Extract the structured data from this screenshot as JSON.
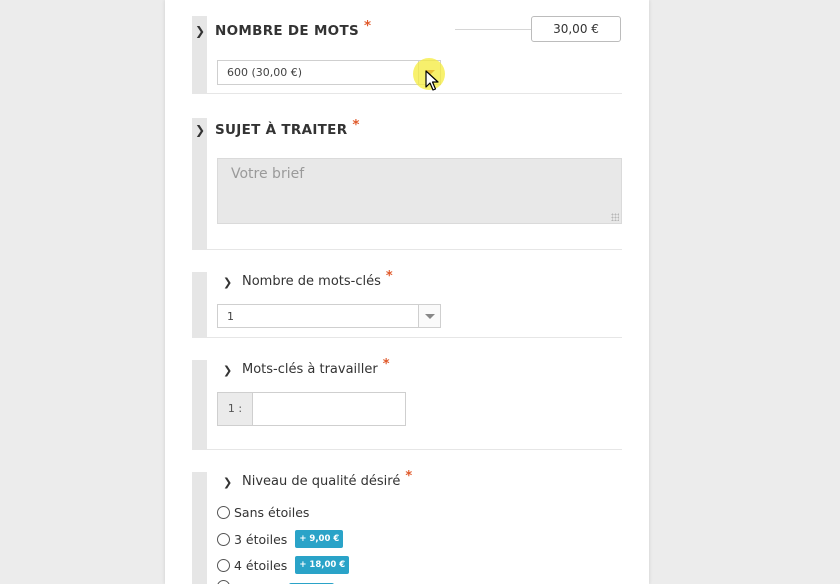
{
  "form": {
    "word_count": {
      "title": "NOMBRE DE MOTS",
      "required_mark": "*",
      "price": "30,00 €",
      "selected_option": "600 (30,00 €)"
    },
    "subject": {
      "title": "SUJET À TRAITER",
      "required_mark": "*",
      "placeholder": "Votre brief"
    },
    "keyword_count": {
      "title": "Nombre de mots-clés",
      "required_mark": "*",
      "selected_option": "1"
    },
    "keywords": {
      "title": "Mots-clés à travailler",
      "required_mark": "*",
      "prefix": "1 :",
      "value": ""
    },
    "quality": {
      "title": "Niveau de qualité désiré",
      "required_mark": "*",
      "options": [
        {
          "label": "Sans étoiles",
          "badge": ""
        },
        {
          "label": "3 étoiles",
          "badge": "+ 9,00 €"
        },
        {
          "label": "4 étoiles",
          "badge": "+ 18,00 €"
        }
      ]
    }
  },
  "colors": {
    "accent_star": "#e0592a",
    "badge": "#2aa3c8",
    "cursor_highlight": "#f5ec3c"
  },
  "icons": [
    "chevron-right-icon",
    "dropdown-arrow-icon",
    "resize-grip-icon",
    "mouse-pointer-icon"
  ]
}
